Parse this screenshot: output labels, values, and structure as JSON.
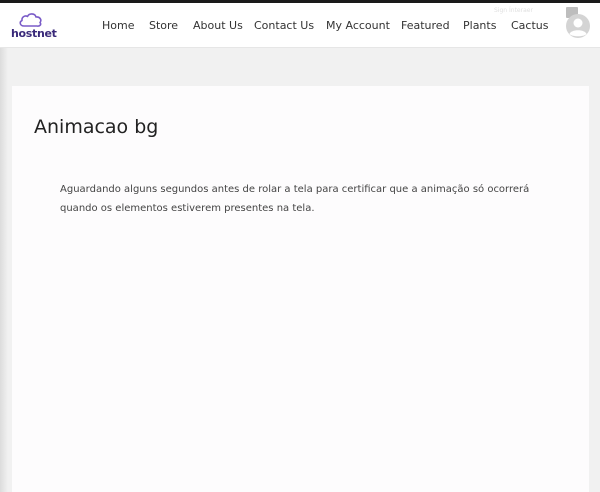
{
  "header": {
    "logo_text": "hostnet",
    "ghost_label": "Sign Ínteraer"
  },
  "nav": {
    "items": [
      {
        "label": "Home"
      },
      {
        "label": "Store"
      },
      {
        "label": "About Us"
      },
      {
        "label": "Contact Us"
      },
      {
        "label": "My Account"
      },
      {
        "label": "Featured"
      },
      {
        "label": "Plants"
      },
      {
        "label": "Cactus"
      }
    ]
  },
  "main": {
    "title": "Animacao bg",
    "body": "Aguardando alguns segundos antes de rolar a tela para certificar que a animação só ocorrerá quando os elementos estiverem presentes na tela."
  },
  "colors": {
    "logo": "#3a2a7a",
    "logo_accent": "#7a5cc8",
    "page_bg": "#f1f1f1",
    "card_bg": "#fdfcfd",
    "text": "#444444"
  },
  "icons": {
    "logo": "cloud-logo-icon",
    "avatar": "user-avatar-icon"
  }
}
